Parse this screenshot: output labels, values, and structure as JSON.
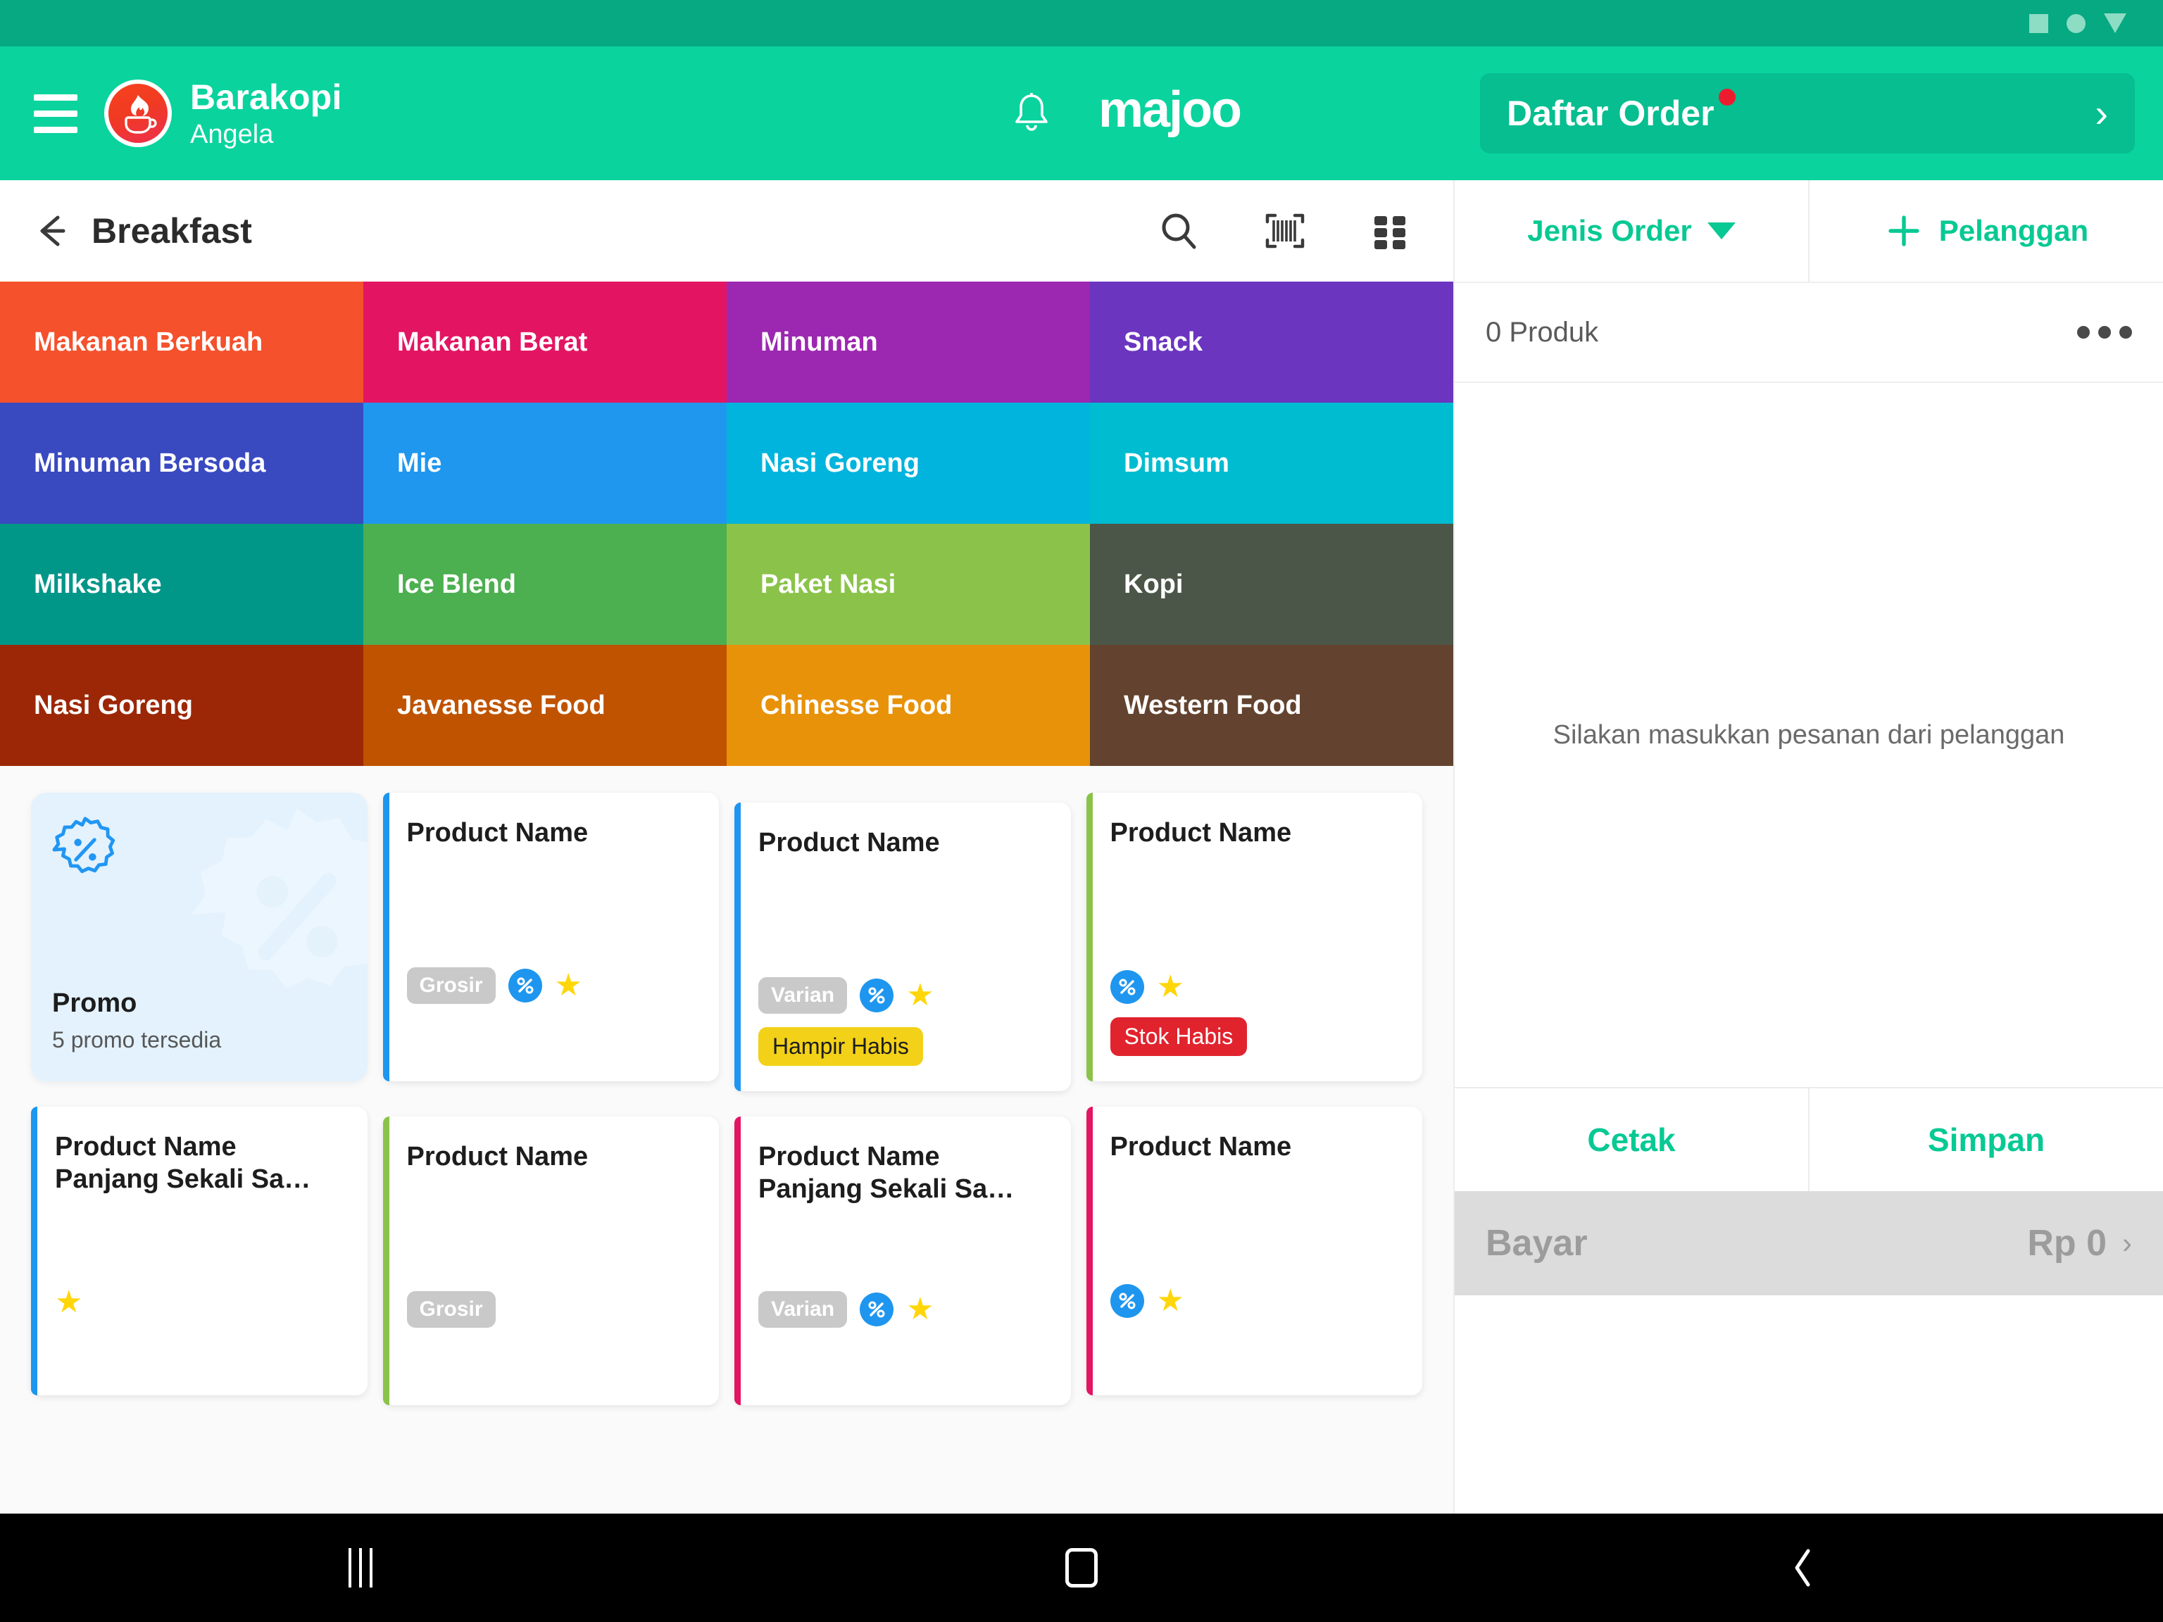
{
  "status_bar": {
    "icons": [
      "square-icon",
      "circle-icon",
      "triangle-down-icon"
    ]
  },
  "header": {
    "menu_icon": "hamburger-menu-icon",
    "logo_icon": "barakopi-flame-cup-logo",
    "store_name": "Barakopi",
    "user_name": "Angela",
    "bell_icon": "notification-bell-icon",
    "brand_logo_text": "majoo",
    "order_button": {
      "label": "Daftar Order",
      "has_notification_dot": true,
      "chevron": "›"
    }
  },
  "toolbar": {
    "back_icon": "back-arrow-icon",
    "title": "Breakfast",
    "icons": [
      "search-icon",
      "barcode-scan-icon",
      "grid-view-icon"
    ]
  },
  "categories": [
    {
      "label": "Makanan Berkuah",
      "color": "#f4512c"
    },
    {
      "label": "Makanan Berat",
      "color": "#e31562"
    },
    {
      "label": "Minuman",
      "color": "#9c27b0"
    },
    {
      "label": "Snack",
      "color": "#6b35c0"
    },
    {
      "label": "Minuman Bersoda",
      "color": "#3949c0"
    },
    {
      "label": "Mie",
      "color": "#1f97ef"
    },
    {
      "label": "Nasi Goreng",
      "color": "#00b4dd"
    },
    {
      "label": "Dimsum",
      "color": "#00bcd0"
    },
    {
      "label": "Milkshake",
      "color": "#009688"
    },
    {
      "label": "Ice Blend",
      "color": "#4caf50"
    },
    {
      "label": "Paket Nasi",
      "color": "#8bc34a"
    },
    {
      "label": "Kopi",
      "color": "#4c5648"
    },
    {
      "label": "Nasi Goreng",
      "color": "#9c2706"
    },
    {
      "label": "Javanesse Food",
      "color": "#bf5300"
    },
    {
      "label": "Chinesse Food",
      "color": "#e8920a"
    },
    {
      "label": "Western Food",
      "color": "#63432f"
    }
  ],
  "promo_card": {
    "icon": "discount-badge-icon",
    "title": "Promo",
    "subtitle": "5 promo tersedia",
    "bg_color": "#e3f2fd"
  },
  "products": [
    {
      "name": "Product Name",
      "accent": "#1e96ef",
      "pill": "Grosir",
      "discount": true,
      "favorite": true,
      "stock_tag": null,
      "offset": false
    },
    {
      "name": "Product Name",
      "accent": "#1e96ef",
      "pill": "Varian",
      "discount": true,
      "favorite": true,
      "stock_tag": "Hampir Habis",
      "stock_style": "warn",
      "offset": true
    },
    {
      "name": "Product Name",
      "accent": "#8bc34a",
      "pill": null,
      "discount": true,
      "favorite": true,
      "stock_tag": "Stok Habis",
      "stock_style": "out",
      "offset": false
    },
    {
      "name": "Product Name Panjang Sekali Sa…",
      "accent": "#1e96ef",
      "pill": null,
      "discount": false,
      "favorite": true,
      "stock_tag": null,
      "offset": false
    },
    {
      "name": "Product Name",
      "accent": "#8bc34a",
      "pill": "Grosir",
      "discount": false,
      "favorite": false,
      "stock_tag": null,
      "offset": true
    },
    {
      "name": "Product Name Panjang Sekali Sa…",
      "accent": "#e31562",
      "pill": "Varian",
      "discount": true,
      "favorite": true,
      "stock_tag": null,
      "offset": true
    },
    {
      "name": "Product Name",
      "accent": "#e31562",
      "pill": null,
      "discount": true,
      "favorite": true,
      "stock_tag": null,
      "offset": false
    }
  ],
  "order_panel": {
    "order_type_label": "Jenis Order",
    "add_customer_label": "Pelanggan",
    "add_customer_icon": "plus-icon",
    "product_count_label": "0 Produk",
    "more_icon": "more-horizontal-icon",
    "empty_message": "Silakan masukkan pesanan dari pelanggan",
    "print_label": "Cetak",
    "save_label": "Simpan",
    "pay_label": "Bayar",
    "pay_amount": "Rp 0",
    "pay_chevron": "›"
  },
  "nav_bar": {
    "recent_icon": "recent-apps-icon",
    "home_icon": "home-icon",
    "back_icon": "back-nav-icon"
  },
  "colors": {
    "brand_green": "#0ad39e",
    "brand_green_dark": "#06a981",
    "accent_green": "#07c993",
    "discount_blue": "#1e96ef",
    "star_yellow": "#ffd60a"
  }
}
